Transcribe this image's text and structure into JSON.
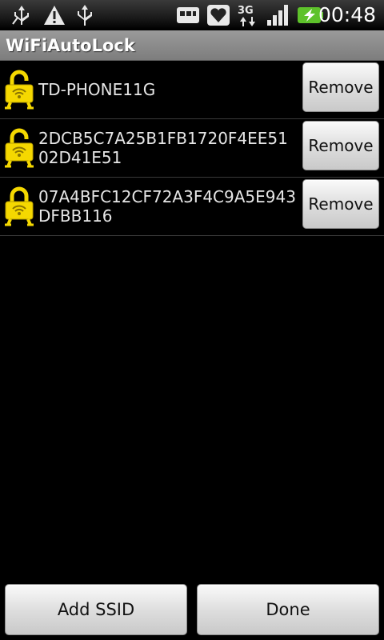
{
  "status_bar": {
    "icons": [
      "usb-debug-icon",
      "warning-icon",
      "usb-icon",
      "sd-card-icon",
      "health-icon",
      "3g-icon",
      "signal-icon",
      "battery-charging-icon"
    ],
    "network_label": "3G",
    "time": "00:48"
  },
  "app": {
    "title": "WiFiAutoLock"
  },
  "ssid_list": {
    "items": [
      {
        "ssid": "TD-PHONE11G",
        "remove_label": "Remove",
        "icon": "lock-icon"
      },
      {
        "ssid": "2DCB5C7A25B1FB1720F4EE5102D41E51",
        "remove_label": "Remove",
        "icon": "lock-icon"
      },
      {
        "ssid": "07A4BFC12CF72A3F4C9A5E943DFBB116",
        "remove_label": "Remove",
        "icon": "lock-icon"
      }
    ]
  },
  "actions": {
    "add_ssid_label": "Add SSID",
    "done_label": "Done"
  },
  "colors": {
    "background": "#000000",
    "title_bar": "#8a8a8a",
    "lock_yellow": "#f5d800",
    "battery_green": "#5ec22b"
  }
}
